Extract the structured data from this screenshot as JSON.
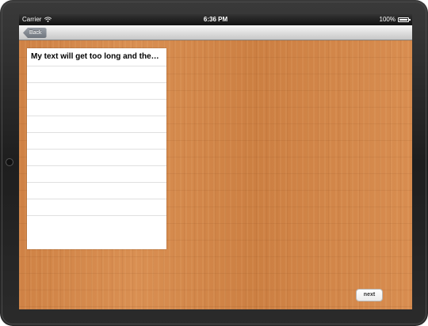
{
  "status_bar": {
    "carrier": "Carrier",
    "time": "6:36 PM",
    "battery": "100%",
    "battery_level": 1.0
  },
  "nav_bar": {
    "back_label": "Back"
  },
  "table": {
    "header": "My text will get too long and then...",
    "row_count": 10
  },
  "footer": {
    "next_label": "next"
  }
}
